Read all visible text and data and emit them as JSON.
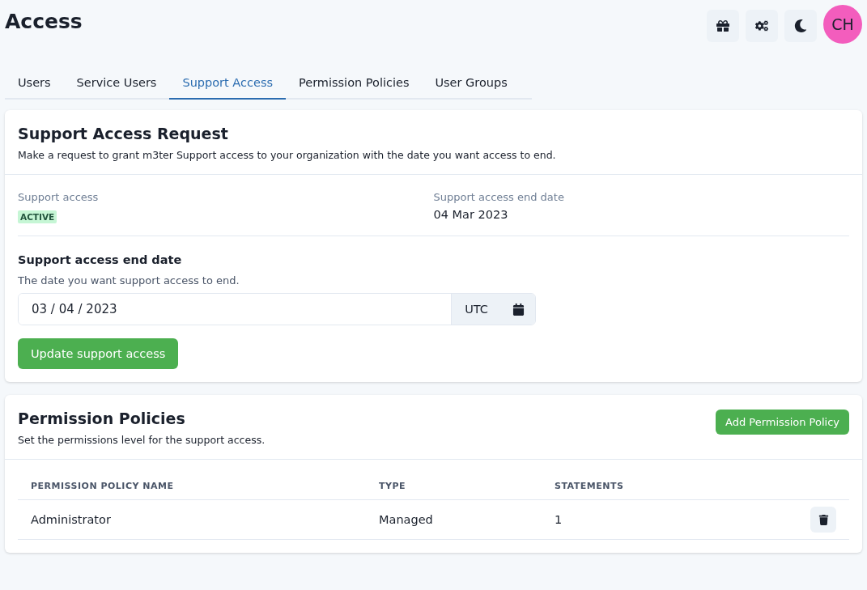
{
  "page": {
    "title": "Access"
  },
  "header_actions": [
    {
      "kind": "gift"
    },
    {
      "kind": "gears"
    },
    {
      "kind": "moon"
    }
  ],
  "avatar": {
    "initials": "CH"
  },
  "tabs": [
    {
      "label": "Users",
      "selected": false
    },
    {
      "label": "Service Users",
      "selected": false
    },
    {
      "label": "Support Access",
      "selected": true
    },
    {
      "label": "Permission Policies",
      "selected": false
    },
    {
      "label": "User Groups",
      "selected": false
    }
  ],
  "support_request": {
    "title": "Support Access Request",
    "description": "Make a request to grant m3ter Support access to your organization with the date you want access to end.",
    "status_label": "Support access",
    "status": "ACTIVE",
    "end_label": "Support access end date",
    "end_value": "04 Mar 2023",
    "form_title": "Support access end date",
    "form_hint": "The date you want support access to end.",
    "date_value": "03 / 04 / 2023",
    "timezone": "UTC",
    "submit": "Update support access"
  },
  "permission_policies": {
    "title": "Permission Policies",
    "description": "Set the permissions level for the support access.",
    "add_button": "Add Permission Policy",
    "columns": [
      "PERMISSION POLICY NAME",
      "TYPE",
      "STATEMENTS"
    ],
    "rows": [
      {
        "name": "Administrator",
        "type": "Managed",
        "statements": "1"
      }
    ]
  }
}
